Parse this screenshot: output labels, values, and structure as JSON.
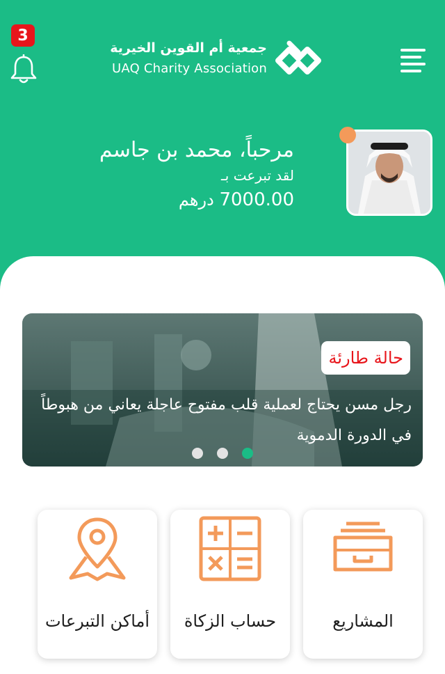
{
  "header": {
    "notification_count": "3",
    "logo_arabic": "جمعية أم القوين الخيرية",
    "logo_english": "UAQ Charity Association",
    "accent_color": "#1bbc86"
  },
  "profile": {
    "welcome": "مرحباً، محمد بن جاسم",
    "donated_label": "لقد تبرعت بـ",
    "amount_value": "7000.00",
    "amount_currency": "درهم",
    "status_dot_color": "#f39a5a"
  },
  "banner": {
    "tag": "حالة طارئة",
    "text": "رجل مسن يحتاج لعملية قلب مفتوح عاجلة يعاني من هبوطاً في الدورة الدموية",
    "slide_count": 3,
    "active_slide": 3
  },
  "cards": [
    {
      "label": "أماكن التبرعات",
      "icon": "location-pin-map-icon"
    },
    {
      "label": "حساب الزكاة",
      "icon": "calculator-icon"
    },
    {
      "label": "المشاريع",
      "icon": "archive-drawer-icon"
    }
  ]
}
